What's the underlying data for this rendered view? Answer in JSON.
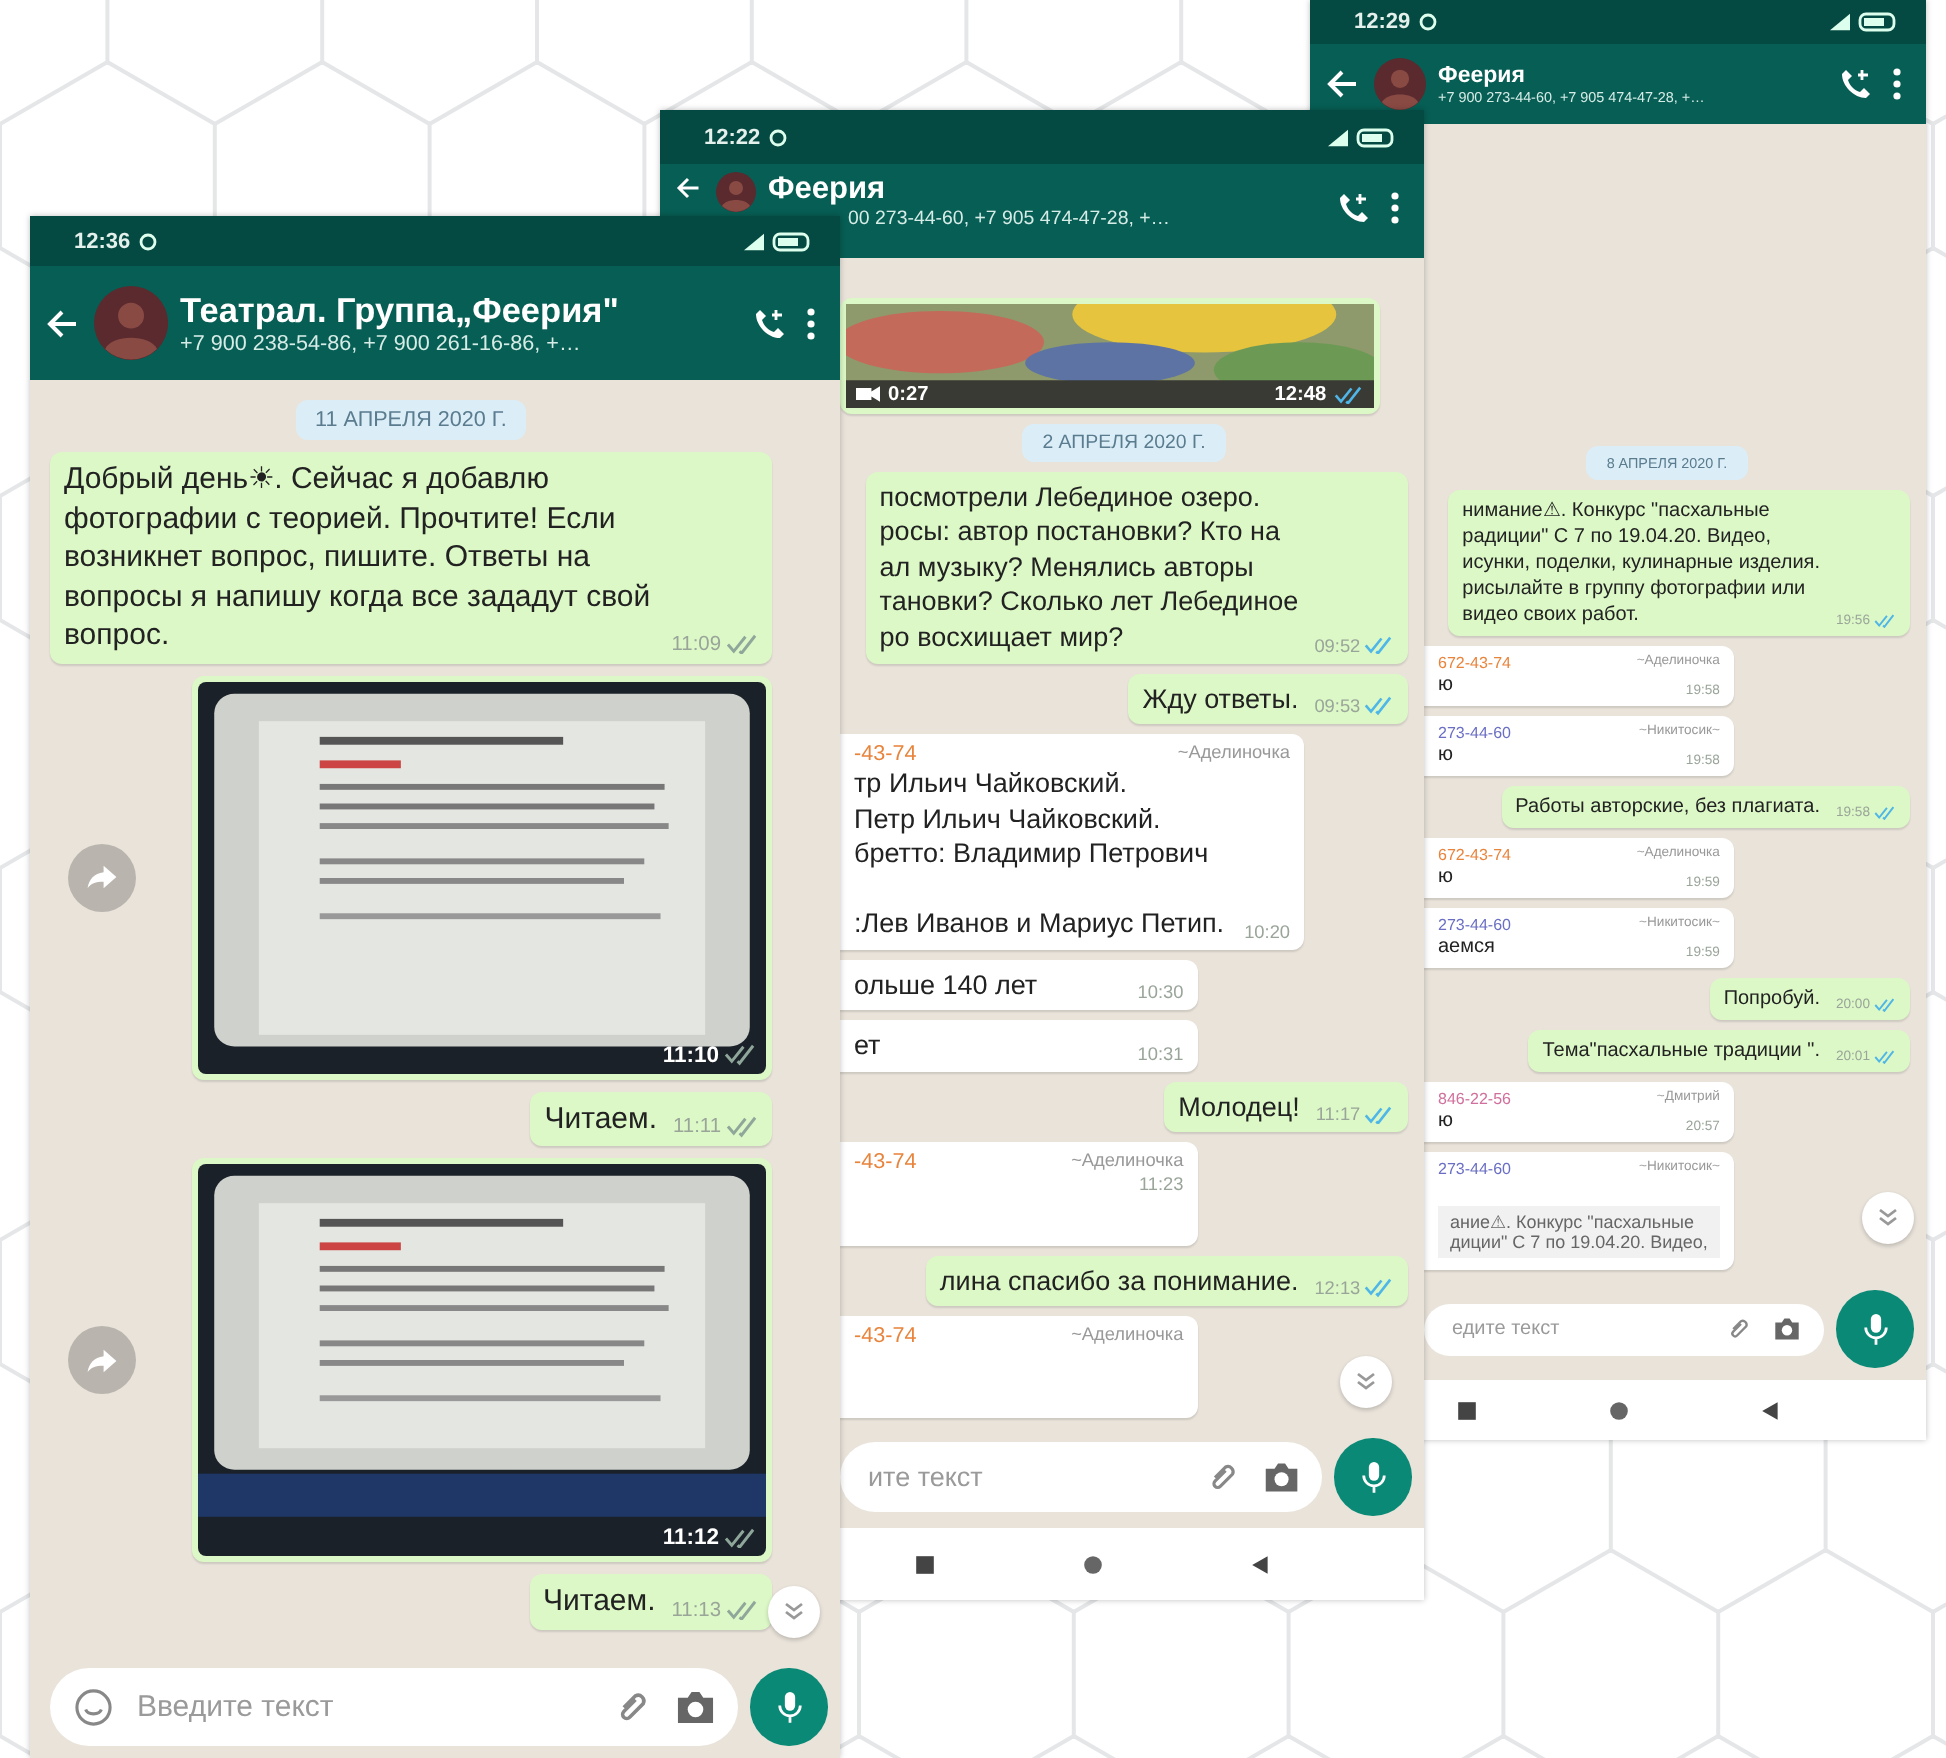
{
  "phones": [
    {
      "status_time": "12:36",
      "title": "Театрал. Группа„Феерия\"",
      "subtitle": "+7 900 238-54-86, +7 900 261-16-86, +…",
      "placeholder": "Введите текст",
      "messages": [
        {
          "kind": "date",
          "text": "11 АПРЕЛЯ 2020 Г."
        },
        {
          "kind": "out",
          "text": "Добрый день☀. Сейчас я добавлю фотографии с теорией. Прочтите! Если возникнет вопрос, пишите. Ответы на вопросы я напишу когда все зададут свой вопрос.",
          "time": "11:09"
        },
        {
          "time": "11:10"
        },
        {
          "kind": "out",
          "text": "Читаем.",
          "time": "11:11"
        },
        {
          "time": "11:12"
        },
        {
          "kind": "out",
          "text": "Читаем.",
          "time": "11:13"
        }
      ]
    },
    {
      "status_time": "12:22",
      "title": "Феерия",
      "subtitle": "00 273-44-60, +7 905 474-47-28, +…",
      "placeholder": "ите текст",
      "messages": [
        {
          "kind": "video",
          "duration": "0:27",
          "time": "12:48"
        },
        {
          "kind": "date",
          "text": "2 АПРЕЛЯ 2020 Г."
        },
        {
          "kind": "out",
          "text": "посмотрели Лебединое озеро.\nросы: автор постановки? Кто на\nал музыку? Менялись авторы\nтановки? Сколько лет Лебединое\nро восхищает мир?",
          "time": "09:52"
        },
        {
          "kind": "out",
          "text": "Жду ответы.",
          "time": "09:53"
        },
        {
          "kind": "in",
          "sender": "-43-74",
          "name": "~Аделиночка",
          "color": "#e8843c",
          "text": "тр Ильич Чайковский.\nПетр Ильич Чайковский.\nбретто: Владимир Петрович\n\n:Лев Иванов и Мариус Петип.",
          "time": "10:20"
        },
        {
          "kind": "in",
          "text": "ольше 140 лет",
          "time": "10:30"
        },
        {
          "kind": "in",
          "text": "ет",
          "time": "10:31"
        },
        {
          "kind": "out",
          "text": "Молодец!",
          "time": "11:17"
        },
        {
          "kind": "in",
          "sender": "-43-74",
          "name": "~Аделиночка",
          "color": "#e8843c",
          "time": "11:23"
        },
        {
          "kind": "out",
          "text": "лина спасибо за понимание.",
          "time": "12:13"
        },
        {
          "kind": "in",
          "sender": "-43-74",
          "name": "~Аделиночка",
          "color": "#e8843c"
        }
      ]
    },
    {
      "status_time": "12:29",
      "title": "Феерия",
      "subtitle": "+7 900 273-44-60, +7 905 474-47-28, +…",
      "placeholder": "едите текст",
      "messages": [
        {
          "kind": "date",
          "text": "8 АПРЕЛЯ 2020 Г."
        },
        {
          "kind": "out",
          "text": "нимание⚠. Конкурс \"пасхальные\nрадиции\" С 7 по 19.04.20. Видео,\nисунки, поделки, кулинарные изделия.\nрисылайте в группу фотографии или\nвидео своих работ.",
          "time": "19:56"
        },
        {
          "kind": "in",
          "sender": "672-43-74",
          "name": "~Аделиночка",
          "color": "#e8843c",
          "text": "ю",
          "time": "19:58"
        },
        {
          "kind": "in",
          "sender": "273-44-60",
          "name": "~Никитосик~",
          "color": "#6b6fc4",
          "text": "ю",
          "time": "19:58"
        },
        {
          "kind": "out",
          "text": "Работы авторские, без плагиата.",
          "time": "19:58"
        },
        {
          "kind": "in",
          "sender": "672-43-74",
          "name": "~Аделиночка",
          "color": "#e8843c",
          "text": "ю",
          "time": "19:59"
        },
        {
          "kind": "in",
          "sender": "273-44-60",
          "name": "~Никитосик~",
          "color": "#6b6fc4",
          "text": "аемся",
          "time": "19:59"
        },
        {
          "kind": "out",
          "text": "Попробуй.",
          "time": "20:00"
        },
        {
          "kind": "out",
          "text": "Тема\"пасхальные традиции \".",
          "time": "20:01"
        },
        {
          "kind": "in",
          "sender": "846-22-56",
          "name": "~Дмитрий",
          "color": "#d0709c",
          "text": "ю",
          "time": "20:57"
        },
        {
          "kind": "reply",
          "sender": "273-44-60",
          "name": "~Никитосик~",
          "color": "#6b6fc4",
          "quote": "ание⚠. Конкурс \"пасхальные\nдиции\" С 7 по 19.04.20. Видео,"
        }
      ]
    }
  ]
}
